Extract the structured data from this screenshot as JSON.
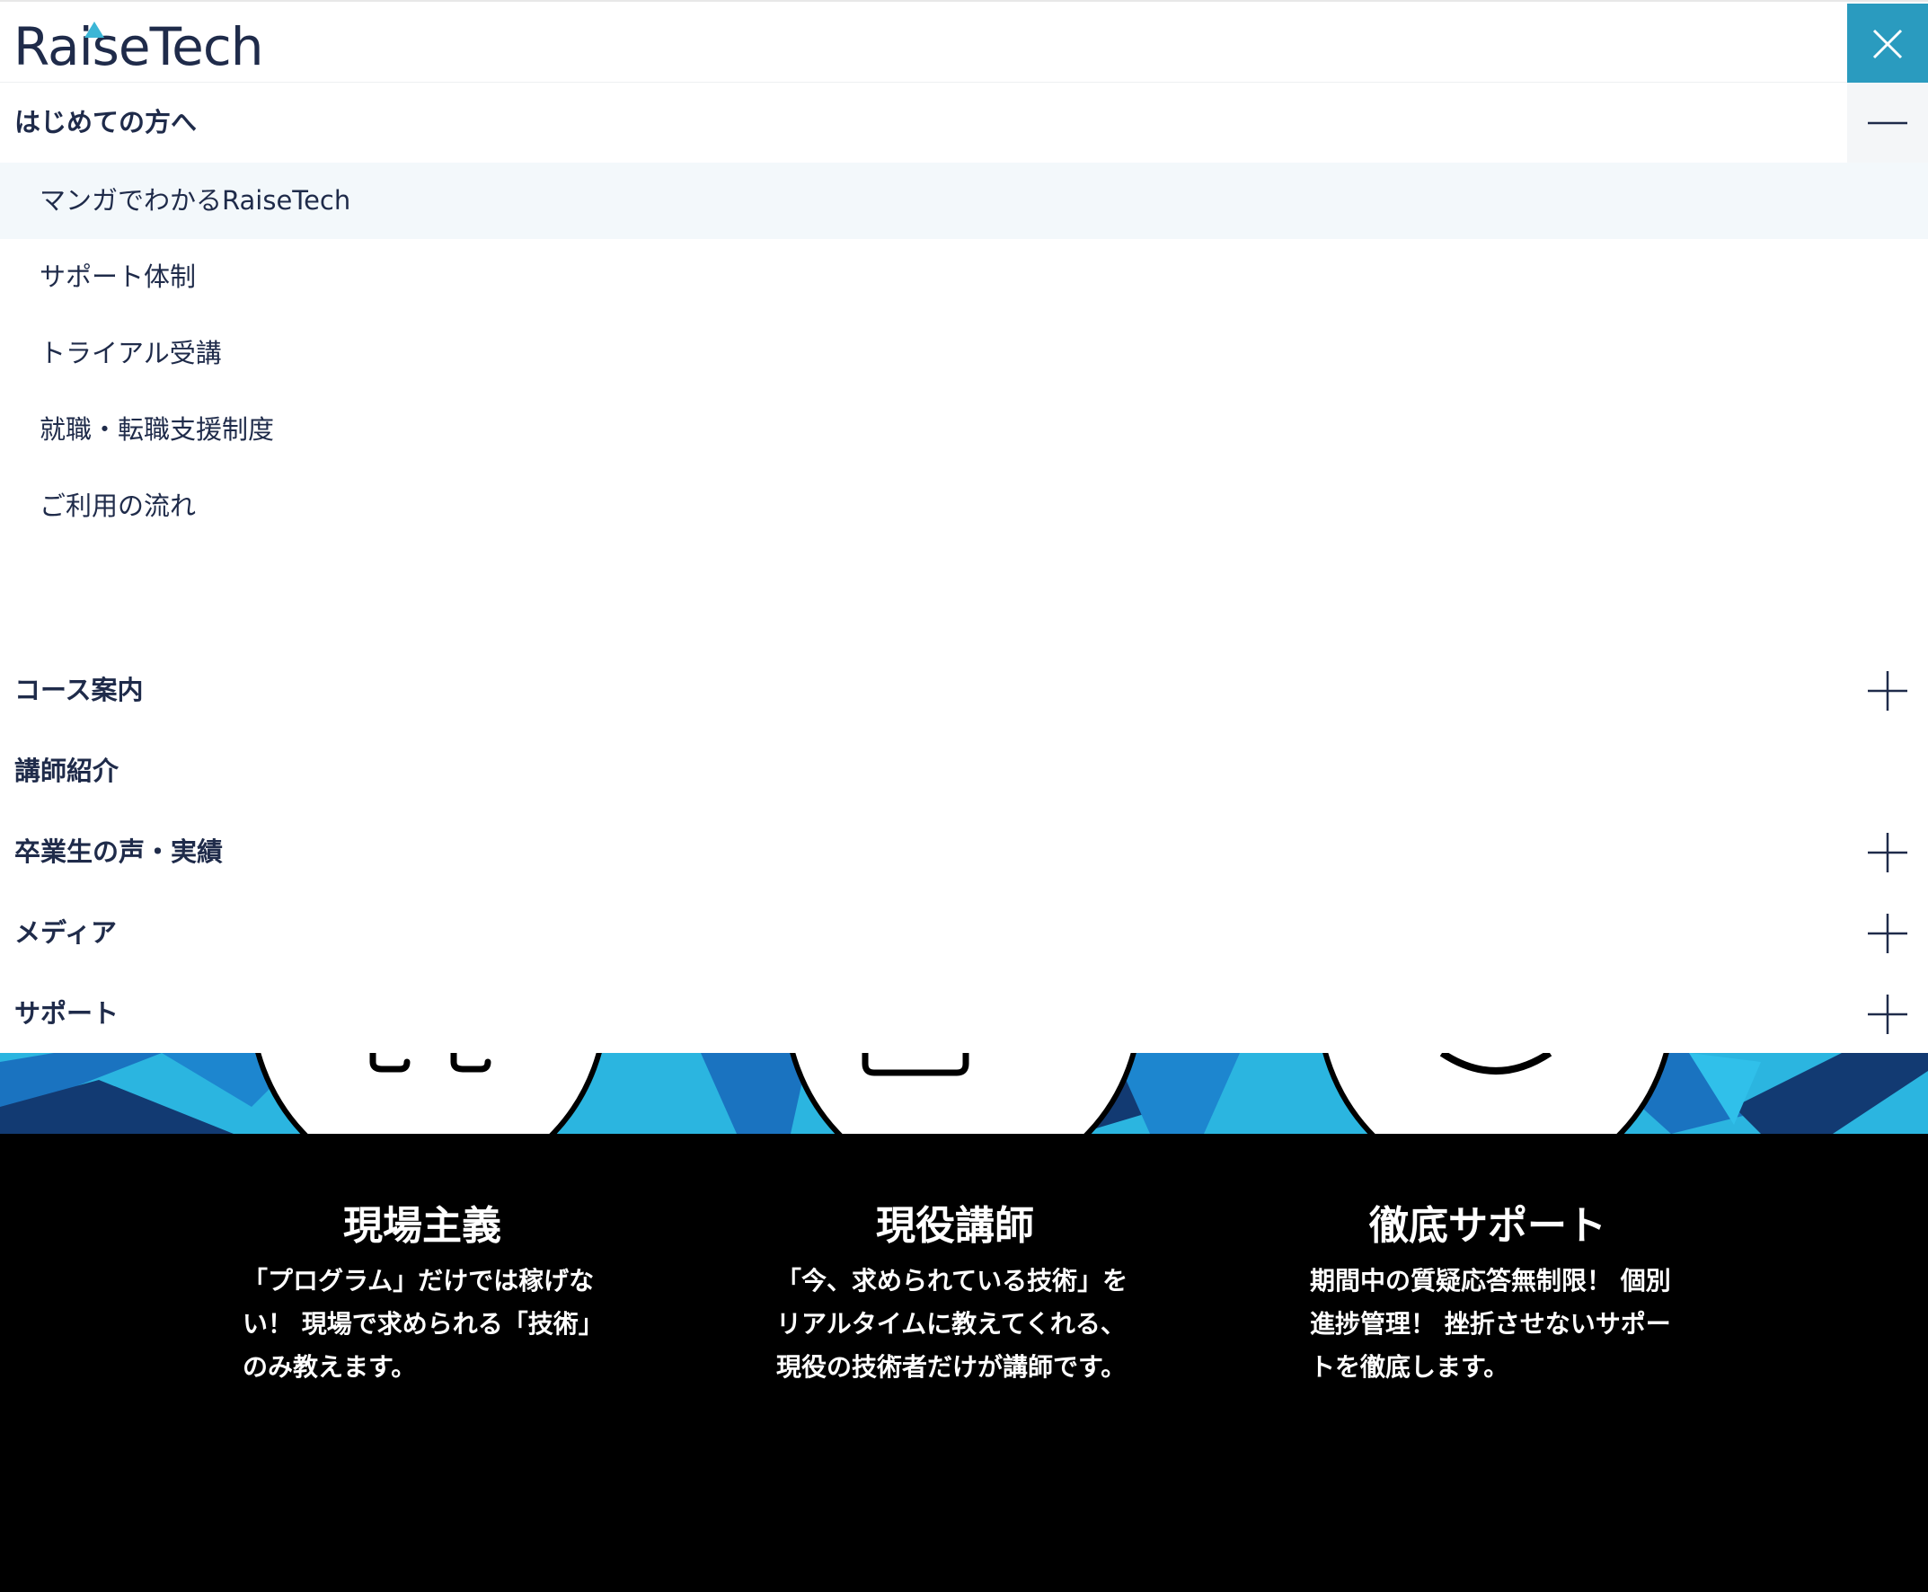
{
  "header": {
    "logo_text": "RaiseTech",
    "close_icon": "close-icon"
  },
  "menu": {
    "sections": [
      {
        "label": "はじめての方へ",
        "state": "expanded",
        "items": [
          {
            "label": "マンガでわかるRaiseTech"
          },
          {
            "label": "サポート体制"
          },
          {
            "label": "トライアル受講"
          },
          {
            "label": "就職・転職支援制度"
          },
          {
            "label": "ご利用の流れ"
          }
        ]
      },
      {
        "label": "コース案内",
        "state": "collapsed"
      },
      {
        "label": "講師紹介",
        "state": "none"
      },
      {
        "label": "卒業生の声・実績",
        "state": "collapsed"
      },
      {
        "label": "メディア",
        "state": "collapsed"
      },
      {
        "label": "サポート",
        "state": "collapsed"
      }
    ]
  },
  "features": [
    {
      "title": "現場主義",
      "text": "「プログラム」だけでは稼げない！ 現場で求められる「技術」のみ教えます。"
    },
    {
      "title": "現役講師",
      "text": "「今、求められている技術」をリアルタイムに教えてくれる、現役の技術者だけが講師です。"
    },
    {
      "title": "徹底サポート",
      "text": "期間中の質疑応答無制限！ 個別進捗管理！ 挫折させないサポートを徹底します。"
    }
  ],
  "colors": {
    "brand_navy": "#1f2b4a",
    "accent_teal": "#2a9bbf",
    "logo_triangle": "#3cb6d6",
    "hero_blue": "#2bb5e0",
    "hero_dark": "#123a72"
  }
}
